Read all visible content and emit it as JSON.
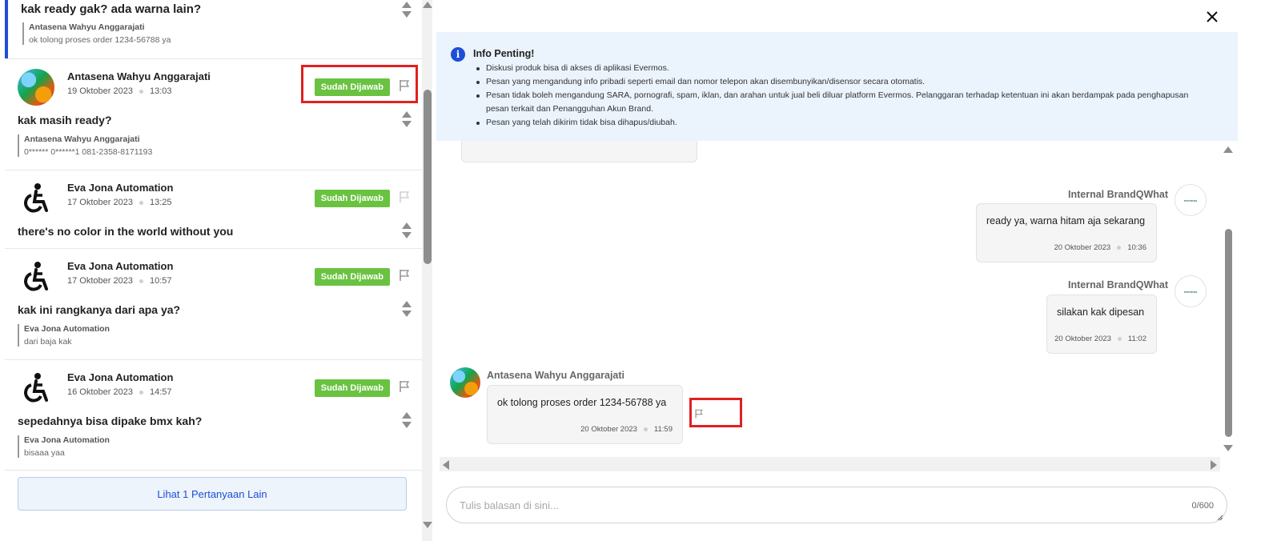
{
  "left_panel": {
    "cards": [
      {
        "question": "kak ready gak? ada warna lain?",
        "reply_name": "Antasena Wahyu Anggarajati",
        "reply_text": "ok tolong proses order 1234-56788 ya"
      },
      {
        "name": "Antasena Wahyu Anggarajati",
        "date": "19 Oktober 2023",
        "time": "13:03",
        "status": "Sudah Dijawab",
        "question": "kak masih ready?",
        "reply_name": "Antasena Wahyu Anggarajati",
        "reply_text": "0****** 0******1 081-2358-8171193"
      },
      {
        "name": "Eva Jona Automation",
        "date": "17 Oktober 2023",
        "time": "13:25",
        "status": "Sudah Dijawab",
        "question": "there's no color in the world without you"
      },
      {
        "name": "Eva Jona Automation",
        "date": "17 Oktober 2023",
        "time": "10:57",
        "status": "Sudah Dijawab",
        "question": "kak ini rangkanya dari apa ya?",
        "reply_name": "Eva Jona Automation",
        "reply_text": "dari baja kak"
      },
      {
        "name": "Eva Jona Automation",
        "date": "16 Oktober 2023",
        "time": "14:57",
        "status": "Sudah Dijawab",
        "question": "sepedahnya bisa dipake bmx kah?",
        "reply_name": "Eva Jona Automation",
        "reply_text": "bisaaa yaa"
      }
    ],
    "more_button": "Lihat 1 Pertanyaan Lain"
  },
  "info": {
    "title": "Info Penting!",
    "items": [
      "Diskusi produk bisa di akses di aplikasi Evermos.",
      "Pesan yang mengandung info pribadi seperti email dan nomor telepon akan disembunyikan/disensor secara otomatis.",
      "Pesan tidak boleh mengandung SARA, pornografi, spam, iklan, dan arahan untuk jual beli diluar platform Evermos. Pelanggaran terhadap ketentuan ini akan berdampak pada penghapusan pesan terkait dan Penangguhan Akun Brand.",
      "Pesan yang telah dikirim tidak bisa dihapus/diubah."
    ]
  },
  "chat": {
    "messages": [
      {
        "sender": "Internal BrandQWhat",
        "text": "ready ya, warna hitam aja sekarang",
        "date": "20 Oktober 2023",
        "time": "10:36"
      },
      {
        "sender": "Internal BrandQWhat",
        "text": "silakan kak dipesan",
        "date": "20 Oktober 2023",
        "time": "11:02"
      },
      {
        "sender": "Antasena Wahyu Anggarajati",
        "text": "ok tolong proses order 1234-56788 ya",
        "date": "20 Oktober 2023",
        "time": "11:59"
      }
    ],
    "brand_logo_text": "evermos"
  },
  "reply": {
    "placeholder": "Tulis balasan di sini...",
    "counter": "0/600"
  },
  "colors": {
    "accent_blue": "#1d4ed8",
    "status_green": "#6ac241",
    "highlight_red": "#e02020",
    "info_bg": "#ebf3fd"
  },
  "icons": [
    "flag-icon",
    "sort-icon",
    "close-icon",
    "info-icon",
    "wheelchair-icon"
  ]
}
